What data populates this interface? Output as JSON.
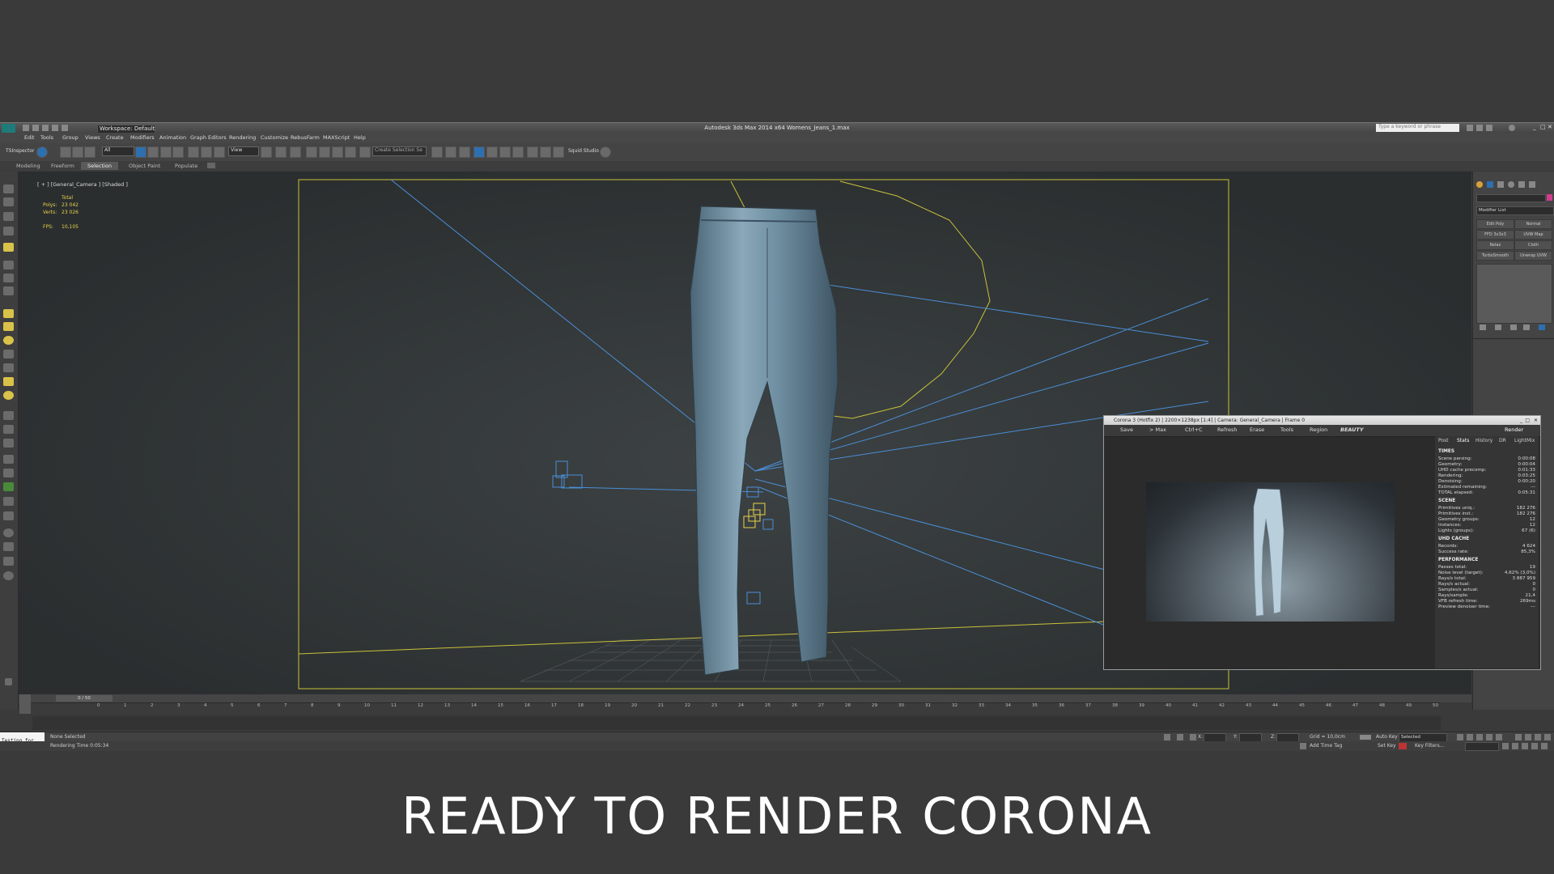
{
  "window": {
    "title": "Autodesk 3ds Max  2014 x64    Womens_Jeans_1.max",
    "workspace": "Workspace: Default",
    "search_placeholder": "Type a keyword or phrase"
  },
  "menu": [
    "Edit",
    "Tools",
    "Group",
    "Views",
    "Create",
    "Modifiers",
    "Animation",
    "Graph Editors",
    "Rendering",
    "Customize",
    "RebusFarm",
    "MAXScript",
    "Help"
  ],
  "toolbar": {
    "left_label": "TSInspector",
    "filter_value": "All",
    "view_value": "View",
    "selection_set": "Create Selection Se",
    "plugin_label": "Squid Studio v"
  },
  "ribbon_tabs": [
    "Modeling",
    "Freeform",
    "Selection",
    "Object Paint",
    "Populate"
  ],
  "ribbon_selected": 2,
  "viewport": {
    "label": "[ + ] [General_Camera ] [Shaded ]",
    "stats_header": "Total",
    "polys_label": "Polys:",
    "polys_value": "23 042",
    "verts_label": "Verts:",
    "verts_value": "23 026",
    "fps_label": "FPS:",
    "fps_value": "10,105"
  },
  "right_panel": {
    "modifier_list": "Modifier List",
    "buttons": [
      "Edit Poly",
      "Normal",
      "FFD 3x3x3",
      "UVW Map",
      "Relax",
      "Cloth",
      "TurboSmooth",
      "Unwrap UVW"
    ]
  },
  "corona": {
    "title": "Corona 3 (Hotfix 2) | 2200×1238px [1:4] | Camera: General_Camera | Frame 0",
    "toolbar": [
      "Save",
      "> Max",
      "Ctrl+C",
      "Refresh",
      "Erase",
      "Tools",
      "Region",
      "BEAUTY"
    ],
    "render_button": "Render",
    "tabs": [
      "Post",
      "Stats",
      "History",
      "DR",
      "LightMix"
    ],
    "sections": [
      {
        "header": "TIMES",
        "rows": [
          [
            "Scene parsing:",
            "0:00:08"
          ],
          [
            "Geometry:",
            "0:00:04"
          ],
          [
            "UHD cache precomp:",
            "0:01:33"
          ],
          [
            "Rendering:",
            "0:03:25"
          ],
          [
            "Denoising:",
            "0:00:20"
          ],
          [
            "Estimated remaining:",
            "---"
          ],
          [
            "TOTAL elapsed:",
            "0:05:31"
          ]
        ]
      },
      {
        "header": "SCENE",
        "rows": [
          [
            "Primitives uniq.:",
            "182 276"
          ],
          [
            "Primitives inst.:",
            "182 276"
          ],
          [
            "Geometry groups:",
            "12"
          ],
          [
            "Instances:",
            "12"
          ],
          [
            "Lights (groups):",
            "67 (6)"
          ]
        ]
      },
      {
        "header": "UHD CACHE",
        "rows": [
          [
            "Records:",
            "4 624"
          ],
          [
            "Success rate:",
            "85,3%"
          ]
        ]
      },
      {
        "header": "PERFORMANCE",
        "rows": [
          [
            "Passes total:",
            "19"
          ],
          [
            "Noise level (target):",
            "4,62% (3,0%)"
          ],
          [
            "Rays/s total:",
            "3 887 959"
          ],
          [
            "Rays/s actual:",
            "0"
          ],
          [
            "Samples/s actual:",
            "0"
          ],
          [
            "Rays/sample:",
            "21,4"
          ],
          [
            "VFB refresh time:",
            "269ms"
          ],
          [
            "Preview denoiser time:",
            "---"
          ]
        ]
      }
    ]
  },
  "timeline": {
    "frame_label": "0 / 50",
    "ticks": [
      "0",
      "1",
      "2",
      "3",
      "4",
      "5",
      "6",
      "7",
      "8",
      "9",
      "10",
      "11",
      "12",
      "13",
      "14",
      "15",
      "16",
      "17",
      "18",
      "19",
      "20",
      "21",
      "22",
      "23",
      "24",
      "25",
      "26",
      "27",
      "28",
      "29",
      "30",
      "31",
      "32",
      "33",
      "34",
      "35",
      "36",
      "37",
      "38",
      "39",
      "40",
      "41",
      "42",
      "43",
      "44",
      "45",
      "46",
      "47",
      "48",
      "49",
      "50"
    ]
  },
  "status": {
    "maxscript_listener": "Testing for",
    "selection": "None Selected",
    "render_time": "Rendering Time  0:05:34",
    "x_label": "X:",
    "y_label": "Y:",
    "z_label": "Z:",
    "grid": "Grid = 10,0cm",
    "add_time_tag": "Add Time Tag",
    "auto_key": "Auto Key",
    "selected": "Selected",
    "set_key": "Set Key",
    "key_filters": "Key Filters..."
  },
  "caption": "READY TO RENDER  CORONA",
  "colors": {
    "background": "#3a3a3a",
    "viewport_frame": "#c9c23a",
    "camera_lines": "#4a8fd6",
    "stats_text": "#e8d24a",
    "accent_blue": "#2e6fb0"
  }
}
